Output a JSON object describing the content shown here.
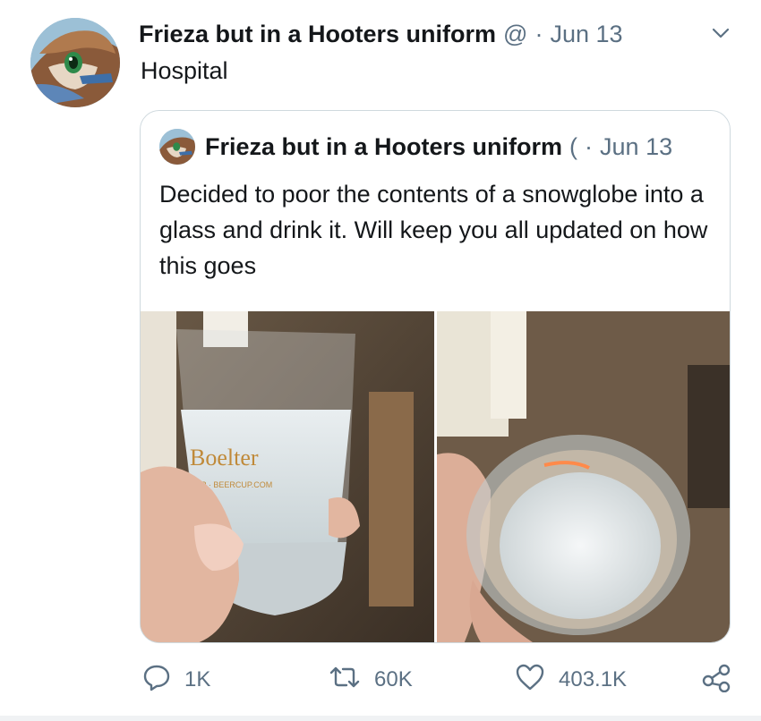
{
  "tweet": {
    "author_name": "Frieza but in a Hooters uniform",
    "handle": "@",
    "separator": "·",
    "date": "Jun 13",
    "text": "Hospital"
  },
  "quoted_tweet": {
    "author_name": "Frieza but in a Hooters uniform",
    "handle": "(",
    "separator": "·",
    "date": "Jun 13",
    "text": "Decided to poor the contents of a snowglobe into a glass and drink it. Will keep you all updated on how this goes",
    "images": [
      {
        "alt_icon": "glass-photo-side-view",
        "glass_print": "Boelter",
        "glass_subprint": "SHOP · BEERCUP.COM"
      },
      {
        "alt_icon": "glass-photo-top-view"
      }
    ]
  },
  "actions": {
    "reply_count": "1K",
    "retweet_count": "60K",
    "like_count": "403.1K",
    "icons": [
      "reply-icon",
      "retweet-icon",
      "like-icon",
      "share-icon"
    ]
  },
  "colors": {
    "text_primary": "#14171a",
    "text_secondary": "#5b7083",
    "border": "#cfd9de"
  }
}
